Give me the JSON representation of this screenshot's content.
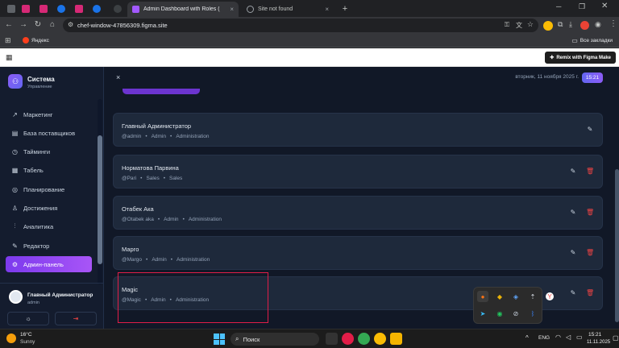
{
  "browser": {
    "tabs": [
      {
        "title": "Admin Dashboard with Roles (",
        "close": "×"
      },
      {
        "title": "Site not found",
        "close": "×"
      }
    ],
    "new_tab": "+",
    "url": "chef-window-47856309.figma.site",
    "bookmark_yandex": "Яндекс",
    "bookmark_all": "Все закладки"
  },
  "figma": {
    "remix_label": "Remix with Figma Make"
  },
  "sidebar": {
    "app_title": "Система",
    "app_subtitle": "Управление",
    "items": [
      {
        "label": "Маркетинг",
        "icon": "trending-icon"
      },
      {
        "label": "База поставщиков",
        "icon": "database-icon"
      },
      {
        "label": "Тайминги",
        "icon": "clock-icon"
      },
      {
        "label": "Табель",
        "icon": "calendar-icon"
      },
      {
        "label": "Планирование",
        "icon": "target-icon"
      },
      {
        "label": "Достижения",
        "icon": "award-icon"
      },
      {
        "label": "Аналитика",
        "icon": "chart-icon"
      },
      {
        "label": "Редактор",
        "icon": "edit-icon"
      },
      {
        "label": "Админ-панель",
        "icon": "settings-icon"
      }
    ],
    "user_name": "Главный Администратор",
    "user_role": "admin"
  },
  "topbar": {
    "close": "×",
    "date": "вторник, 11 ноября 2025 г.",
    "time": "15:21"
  },
  "users": [
    {
      "name": "Главный Администратор",
      "login": "@admin",
      "role": "Admin",
      "dept": "Administration",
      "deletable": false
    },
    {
      "name": "Норматова Парвина",
      "login": "@Pari",
      "role": "Sales",
      "dept": "Sales",
      "deletable": true
    },
    {
      "name": "Отабек Ака",
      "login": "@Otabek aka",
      "role": "Admin",
      "dept": "Administration",
      "deletable": true
    },
    {
      "name": "Марго",
      "login": "@Margo",
      "role": "Admin",
      "dept": "Administration",
      "deletable": true
    },
    {
      "name": "Magic",
      "login": "@Magic",
      "role": "Admin",
      "dept": "Administration",
      "deletable": true
    }
  ],
  "taskbar": {
    "weather_temp": "16°C",
    "weather_desc": "Sunny",
    "search_placeholder": "Поиск",
    "lang": "ENG",
    "clock_time": "15:21",
    "clock_date": "11.11.2025"
  },
  "colors": {
    "accent": "#8b5cf6",
    "delete": "#ef4444",
    "highlight_box": "#e11d48"
  }
}
